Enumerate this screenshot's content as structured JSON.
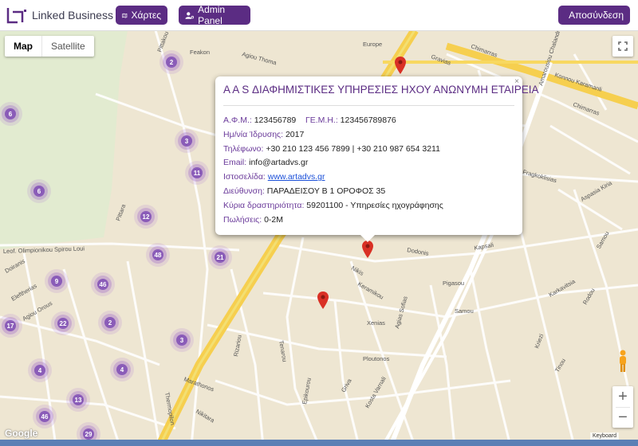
{
  "header": {
    "logo_text": "Linked Business",
    "maps_label": "Χάρτες",
    "admin_label": "Admin Panel",
    "logout_label": "Αποσύνδεση"
  },
  "map_controls": {
    "map_label": "Map",
    "satellite_label": "Satellite",
    "zoom_in": "+",
    "zoom_out": "−",
    "google_label": "Google",
    "keyboard_label": "Keyboard"
  },
  "clusters": [
    "2",
    "6",
    "3",
    "11",
    "6",
    "12",
    "48",
    "21",
    "9",
    "46",
    "17",
    "22",
    "2",
    "3",
    "4",
    "4",
    "13",
    "46",
    "29"
  ],
  "streets": [
    "Pittakou",
    "Feakon",
    "Agiou Thoma",
    "Europe",
    "Gravias",
    "Chimarras",
    "Amarousiou Chalandriou",
    "Konnou Karamanli",
    "Chimarras",
    "Leof. Olimpionikou Spirou Loui",
    "Doiranis",
    "Eleftherias",
    "Agiou Orous",
    "Kapsali",
    "Dodonis",
    "Nikis",
    "Keramikou",
    "Xenias",
    "Pigasou",
    "Samou",
    "Karkavitsia",
    "Fragkoklisias",
    "Aspasia Kiria",
    "Rizariou",
    "Tenarou",
    "Ploutonos",
    "Kosta Varnali",
    "Agias Sofias",
    "Thermopilon",
    "Marathonos",
    "Epikourou",
    "Griva",
    "Nikitara",
    "Rodou",
    "Kriezi",
    "Samou",
    "Tinou",
    "Pittara"
  ],
  "popup": {
    "title": "Α Α S ΔΙΑΦΗΜΙΣΤΙΚΕΣ ΥΠΗΡΕΣΙΕΣ ΗΧΟΥ ΑΝΩΝΥΜΗ ΕΤΑΙΡΕΙΑ",
    "close": "×",
    "afm_label": "Α.Φ.Μ.:",
    "afm_value": "123456789",
    "gemi_label": "ΓΕ.Μ.Η.:",
    "gemi_value": "123456789876",
    "founded_label": "Ημ/νία Ίδρυσης:",
    "founded_value": "2017",
    "phone_label": "Τηλέφωνο:",
    "phone_value": "+30 210 123 456 7899 | +30 210 987 654 3211",
    "email_label": "Email:",
    "email_value": "info@artadvs.gr",
    "website_label": "Ιστοσελίδα:",
    "website_value": "www.artadvs.gr",
    "address_label": "Διεύθυνση:",
    "address_value": "ΠΑΡΑΔΕΙΣΟΥ Β 1 ΟΡΟΦΟΣ 35",
    "activity_label": "Κύρια δραστηριότητα:",
    "activity_value": "59201100 - Υπηρεσίες ηχογράφησης",
    "sales_label": "Πωλήσεις:",
    "sales_value": "0-2M"
  },
  "colors": {
    "brand": "#5b2c83",
    "cluster": "#8a5cb8",
    "pin": "#d93025",
    "highway": "#f6cf4f",
    "map_bg": "#eee6d2"
  }
}
